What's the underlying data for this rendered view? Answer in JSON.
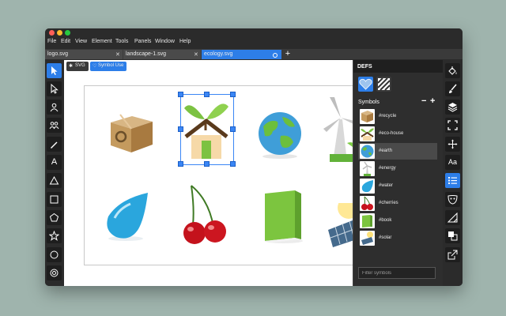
{
  "window": {
    "controls": {
      "close_color": "#ff5f57",
      "minimize_color": "#febc2e",
      "zoom_color": "#28c840"
    }
  },
  "menu": [
    "File",
    "Edit",
    "View",
    "Element",
    "Tools",
    "Panels",
    "Window",
    "Help"
  ],
  "tabs": [
    {
      "label": "logo.svg",
      "active": false
    },
    {
      "label": "landscape-1.svg",
      "active": false
    },
    {
      "label": "ecology.svg",
      "active": true
    }
  ],
  "new_tab_label": "+",
  "tab_close_glyph": "✕",
  "canvas_toolbar": {
    "svg_label": "SVG",
    "symbol_use_label": "Symbol Use",
    "symbol_use_active": true
  },
  "left_tools": [
    {
      "icon": "pointer-arrow-icon",
      "active": true
    },
    {
      "icon": "node-arrow-icon",
      "active": false
    },
    {
      "icon": "user-icon",
      "active": false
    },
    {
      "icon": "users-icon",
      "active": false
    },
    {
      "icon": "pen-icon",
      "active": false
    },
    {
      "icon": "text-icon",
      "active": false,
      "glyph": "A"
    },
    {
      "icon": "triangle-icon",
      "active": false
    },
    {
      "icon": "rectangle-icon",
      "active": false
    },
    {
      "icon": "pentagon-icon",
      "active": false
    },
    {
      "icon": "star-icon",
      "active": false
    },
    {
      "icon": "circle-icon",
      "active": false
    },
    {
      "icon": "ring-icon",
      "active": false
    }
  ],
  "defs": {
    "title": "DEFS",
    "symbols_label": "Symbols",
    "minus": "−",
    "plus": "+",
    "items": [
      {
        "label": "#recycle",
        "icon": "recycle-box-icon"
      },
      {
        "label": "#eco-house",
        "icon": "eco-house-icon"
      },
      {
        "label": "#earth",
        "icon": "earth-icon",
        "selected": true
      },
      {
        "label": "#energy",
        "icon": "wind-turbine-icon"
      },
      {
        "label": "#water",
        "icon": "water-drop-icon"
      },
      {
        "label": "#cherries",
        "icon": "cherries-icon"
      },
      {
        "label": "#book",
        "icon": "book-icon"
      },
      {
        "label": "#solar",
        "icon": "solar-panel-icon"
      }
    ],
    "filter_placeholder": "Filter symbols"
  },
  "right_tools": [
    {
      "icon": "paint-bucket-icon",
      "active": false
    },
    {
      "icon": "brush-icon",
      "active": false
    },
    {
      "icon": "layers-icon",
      "active": false
    },
    {
      "icon": "fullscreen-icon",
      "active": false
    },
    {
      "icon": "move-icon",
      "active": false
    },
    {
      "icon": "font-size-icon",
      "active": false,
      "glyph": "Aa"
    },
    {
      "icon": "list-icon",
      "active": true
    },
    {
      "icon": "mask-icon",
      "active": false
    },
    {
      "icon": "triangle-ruler-icon",
      "active": false
    },
    {
      "icon": "overlap-squares-icon",
      "active": false
    },
    {
      "icon": "export-icon",
      "active": false
    }
  ],
  "colors": {
    "accent": "#2d7ee8",
    "panel": "#2e2e2e",
    "chrome": "#2b2b2b",
    "background": "#9fb4ad"
  }
}
